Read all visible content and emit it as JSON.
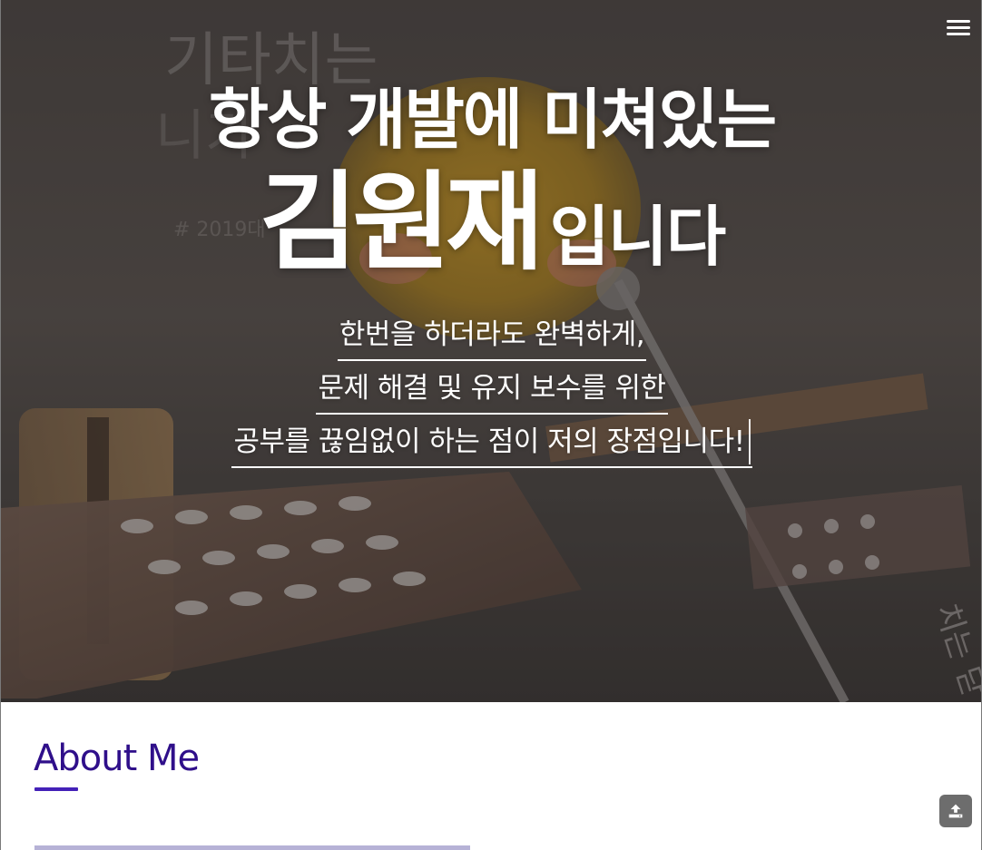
{
  "hero": {
    "title_line1": "항상 개발에 미쳐있는",
    "name": "김원재",
    "name_suffix": "입니다",
    "lines": [
      "한번을 하더라도 완벽하게,",
      "문제 해결 및 유지 보수를 위한",
      "공부를 끊임없이 하는 점이 저의 장점입니다!"
    ]
  },
  "nav": {
    "menu_icon": "hamburger-menu-icon"
  },
  "about": {
    "title": "About Me",
    "accent_color": "#2f0f8a",
    "underline_color": "#4421b8"
  },
  "floating": {
    "top_button_icon": "upload-icon",
    "top_button_color": "#6d6d6d"
  }
}
